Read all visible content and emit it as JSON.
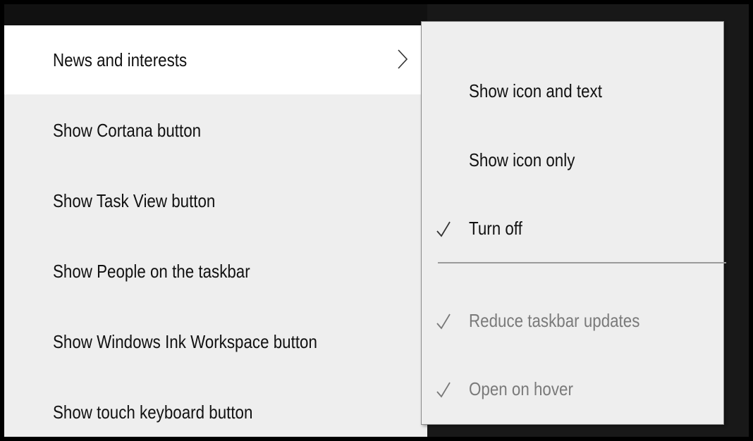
{
  "main_menu": {
    "items": [
      {
        "label": "News and interests",
        "has_submenu": true,
        "highlighted": true
      },
      {
        "label": "Show Cortana button"
      },
      {
        "label": "Show Task View button"
      },
      {
        "label": "Show People on the taskbar"
      },
      {
        "label": "Show Windows Ink Workspace button"
      },
      {
        "label": "Show touch keyboard button"
      }
    ],
    "submenu_arrow_icon": "chevron-right-icon"
  },
  "submenu": {
    "items": [
      {
        "label": "Show icon and text",
        "checked": false,
        "enabled": true
      },
      {
        "label": "Show icon only",
        "checked": false,
        "enabled": true
      },
      {
        "label": "Turn off",
        "checked": true,
        "enabled": true
      },
      {
        "label": "Reduce taskbar updates",
        "checked": true,
        "enabled": false
      },
      {
        "label": "Open on hover",
        "checked": true,
        "enabled": false
      }
    ],
    "check_icon": "checkmark-icon"
  },
  "colors": {
    "menu_background": "#eeeeee",
    "highlight_background": "#ffffff",
    "text": "#111111",
    "disabled_text": "#7a7a7a",
    "frame": "#000000"
  }
}
